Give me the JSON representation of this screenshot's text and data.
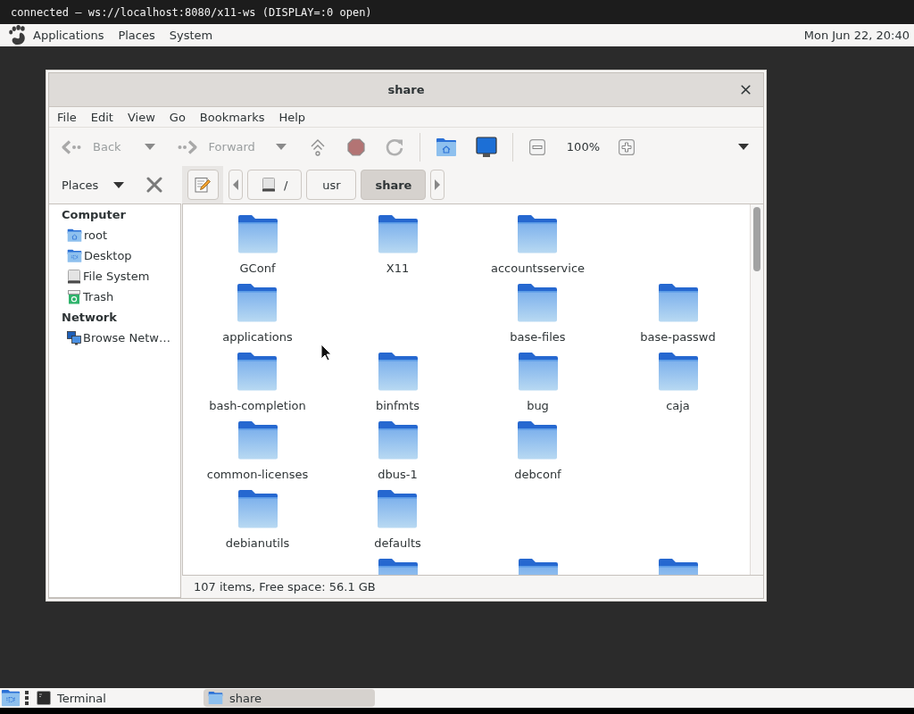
{
  "connection_bar": {
    "text": "connected — ws://localhost:8080/x11-ws (DISPLAY=:0 open)"
  },
  "top_panel": {
    "menus": [
      "Applications",
      "Places",
      "System"
    ],
    "clock": "Mon Jun 22, 20:40"
  },
  "window": {
    "title": "share",
    "menu": [
      "File",
      "Edit",
      "View",
      "Go",
      "Bookmarks",
      "Help"
    ],
    "toolbar": {
      "back": {
        "label": "Back",
        "disabled": true
      },
      "forward": {
        "label": "Forward",
        "disabled": true
      },
      "zoom_level": "100%"
    },
    "location_bar": {
      "places_label": "Places",
      "path": [
        {
          "label": "/",
          "selected": false
        },
        {
          "label": "usr",
          "selected": false
        },
        {
          "label": "share",
          "selected": true
        }
      ]
    },
    "sidebar": {
      "sections": [
        {
          "heading": "Computer",
          "items": [
            {
              "kind": "home",
              "label": "root"
            },
            {
              "kind": "desktop",
              "label": "Desktop"
            },
            {
              "kind": "drive",
              "label": "File System"
            },
            {
              "kind": "trash",
              "label": "Trash"
            }
          ]
        },
        {
          "heading": "Network",
          "items": [
            {
              "kind": "network",
              "label": "Browse Netw…"
            }
          ]
        }
      ]
    },
    "files": {
      "rows": [
        [
          {
            "kind": "folder",
            "label": "GConf"
          },
          {
            "kind": "folder",
            "label": "X11"
          },
          {
            "kind": "folder",
            "label": "accountsservice"
          },
          {
            "kind": "empty"
          }
        ],
        [
          {
            "kind": "folder",
            "label": "applications"
          },
          {
            "kind": "empty"
          },
          {
            "kind": "folder",
            "label": "base-files"
          },
          {
            "kind": "folder",
            "label": "base-passwd"
          }
        ],
        [
          {
            "kind": "folder",
            "label": "bash-completion"
          },
          {
            "kind": "folder",
            "label": "binfmts"
          },
          {
            "kind": "folder",
            "label": "bug"
          },
          {
            "kind": "folder",
            "label": "caja"
          }
        ],
        [
          {
            "kind": "folder",
            "label": "common-licenses"
          },
          {
            "kind": "folder",
            "label": "dbus-1"
          },
          {
            "kind": "folder",
            "label": "debconf"
          },
          {
            "kind": "empty"
          }
        ],
        [
          {
            "kind": "folder",
            "label": "debianutils"
          },
          {
            "kind": "folder",
            "label": "defaults"
          },
          {
            "kind": "empty"
          },
          {
            "kind": "empty"
          }
        ],
        [
          {
            "kind": "empty"
          },
          {
            "kind": "folder"
          },
          {
            "kind": "folder"
          },
          {
            "kind": "folder"
          }
        ]
      ]
    },
    "status_bar": "107 items, Free space: 56.1 GB"
  },
  "taskbar": {
    "tasks": [
      {
        "kind": "terminal",
        "label": "Terminal",
        "selected": false
      },
      {
        "kind": "folder",
        "label": "share",
        "selected": true
      }
    ]
  }
}
